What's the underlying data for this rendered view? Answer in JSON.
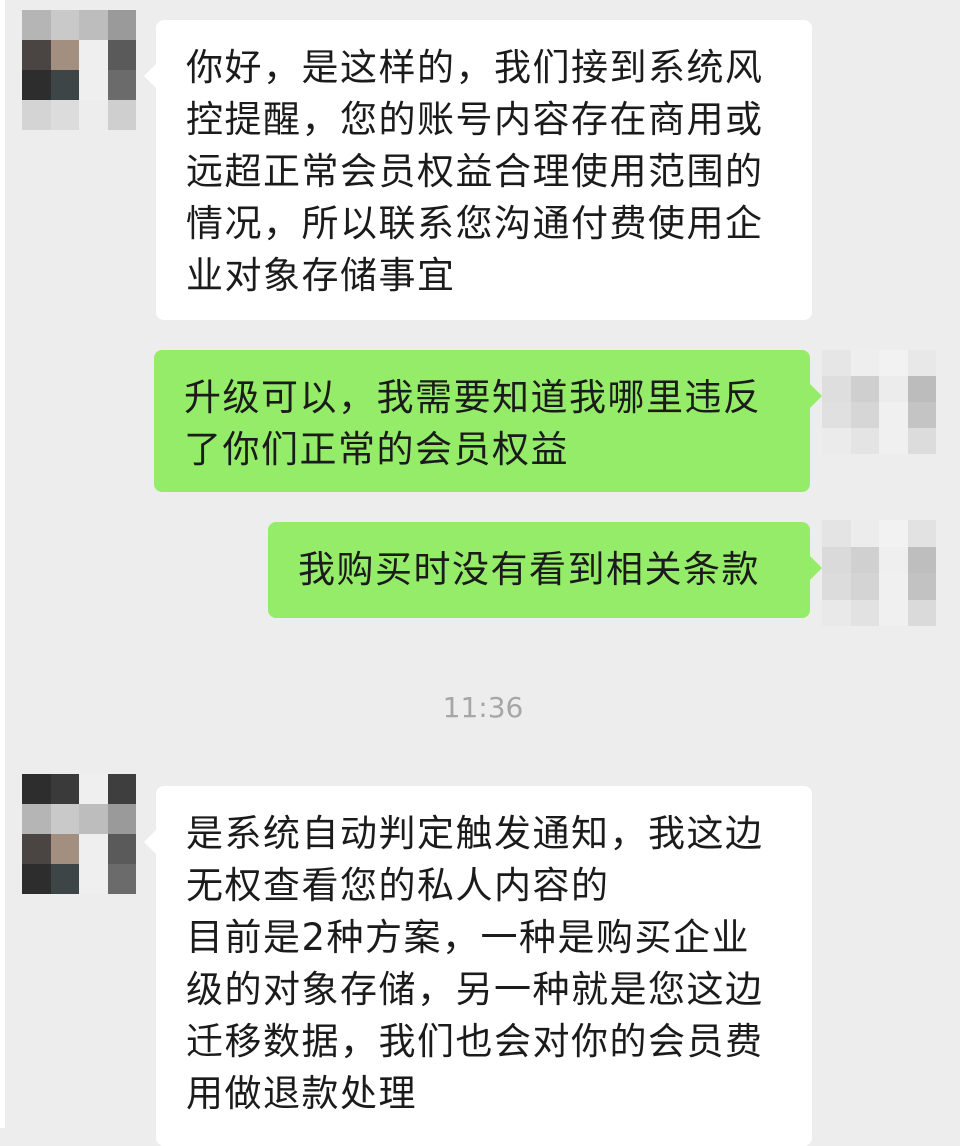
{
  "chat": {
    "messages": [
      {
        "side": "received",
        "lines": [
          "你好，是这样的，我们接到系统风",
          "控提醒，您的账号内容存在商用或",
          "远超正常会员权益合理使用范围的",
          "情况，所以联系您沟通付费使用企",
          "业对象存储事宜"
        ]
      },
      {
        "side": "sent",
        "lines": [
          "升级可以，我需要知道我哪里违反",
          "了你们正常的会员权益"
        ]
      },
      {
        "side": "sent",
        "lines": [
          "我购买时没有看到相关条款"
        ]
      },
      {
        "side": "received",
        "lines": [
          "是系统自动判定触发通知，我这边",
          "无权查看您的私人内容的",
          "目前是2种方案，一种是购买企业",
          "级的对象存储，另一种就是您这边",
          "迁移数据，我们也会对你的会员费",
          "用做退款处理"
        ]
      }
    ],
    "timestamp": "11:36"
  },
  "theme": {
    "background": "#ededed",
    "received_bubble": "#ffffff",
    "sent_bubble": "#95ec69",
    "text": "#1b1b1b",
    "timestamp_text": "#a6a6a6"
  },
  "avatars": {
    "contact": "contact-avatar",
    "self": "self-avatar"
  }
}
